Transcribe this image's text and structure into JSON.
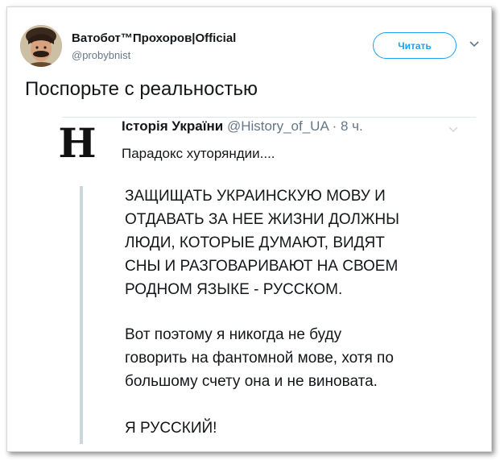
{
  "tweet": {
    "author_name": "Ватобот™Прохоров|Official",
    "author_handle": "@probybnist",
    "follow_label": "Читать",
    "text": "Поспорьте с реальностью"
  },
  "quoted": {
    "logo_letter": "Н",
    "name": "Історія України",
    "handle": "@History_of_UA",
    "time": "· 8 ч.",
    "line1": "Парадокс хуторяндии....",
    "paragraph1": [
      "ЗАЩИЩАТЬ УКРАИНСКУЮ МОВУ И",
      "ОТДАВАТЬ ЗА НЕЕ ЖИЗНИ ДОЛЖНЫ",
      "ЛЮДИ, КОТОРЫЕ ДУМАЮТ, ВИДЯТ",
      "СНЫ И РАЗГОВАРИВАЮТ НА СВОЕМ",
      "РОДНОМ ЯЗЫКЕ - РУССКОМ."
    ],
    "paragraph2": [
      "Вот поэтому я никогда не буду",
      "говорить на фантомной мове, хотя по",
      "большому счету она и не виновата."
    ],
    "paragraph3": "Я РУССКИЙ!"
  },
  "colors": {
    "accent": "#1da1f2",
    "muted": "#657786",
    "text": "#14171a",
    "divider": "#ccd6dd"
  },
  "icons": [
    "avatar",
    "chevron-down-icon"
  ]
}
